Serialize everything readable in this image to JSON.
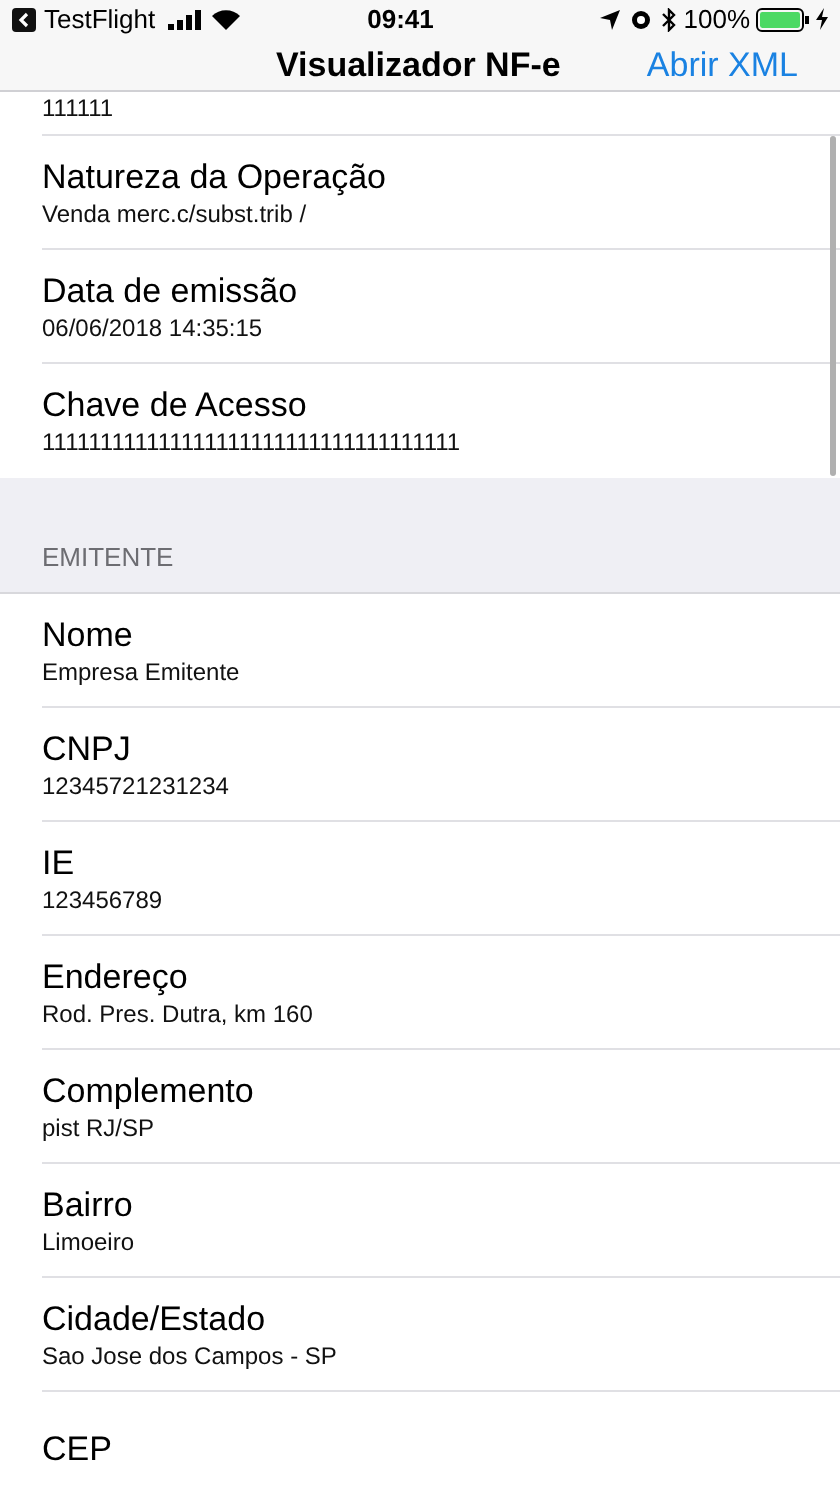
{
  "status_bar": {
    "back_app": "TestFlight",
    "time": "09:41",
    "battery": "100%"
  },
  "nav": {
    "title": "Visualizador NF-e",
    "action": "Abrir XML"
  },
  "sections": [
    {
      "rows": [
        {
          "value": "111111"
        },
        {
          "label": "Natureza da Operação",
          "value": "Venda merc.c/subst.trib /"
        },
        {
          "label": "Data de emissão",
          "value": "06/06/2018 14:35:15"
        },
        {
          "label": "Chave de Acesso",
          "value": "111111111111111111111111111111111111"
        }
      ]
    },
    {
      "header": "EMITENTE",
      "rows": [
        {
          "label": "Nome",
          "value": "Empresa Emitente"
        },
        {
          "label": "CNPJ",
          "value": "12345721231234"
        },
        {
          "label": "IE",
          "value": "123456789"
        },
        {
          "label": "Endereço",
          "value": "Rod. Pres. Dutra, km 160"
        },
        {
          "label": "Complemento",
          "value": "pist RJ/SP"
        },
        {
          "label": "Bairro",
          "value": "Limoeiro"
        },
        {
          "label": "Cidade/Estado",
          "value": "Sao Jose dos Campos - SP"
        },
        {
          "label": "CEP"
        }
      ]
    }
  ]
}
